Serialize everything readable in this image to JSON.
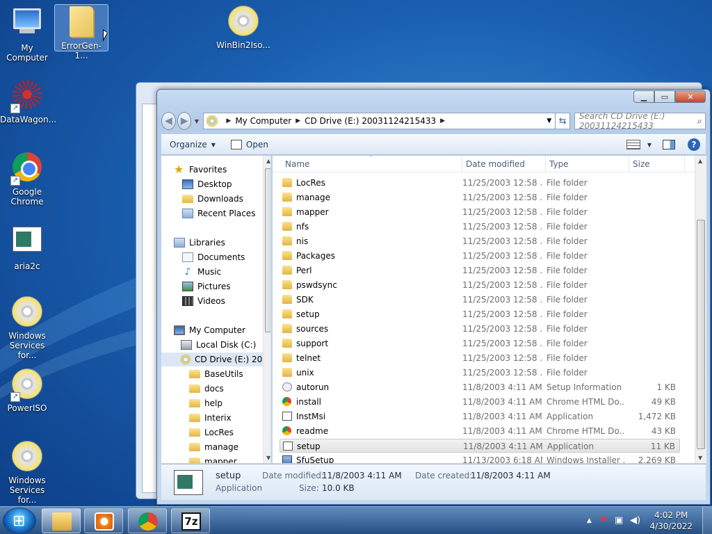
{
  "desktop": {
    "icons": [
      {
        "label": "My Computer"
      },
      {
        "label": "ErrorGen-1..."
      },
      {
        "label": "WinBin2Iso..."
      },
      {
        "label": "DataWagon..."
      },
      {
        "label": "Google Chrome"
      },
      {
        "label": "aria2c"
      },
      {
        "label": "Windows Services for..."
      },
      {
        "label": "PowerISO"
      },
      {
        "label": "Windows Services for..."
      }
    ]
  },
  "window": {
    "address": {
      "root": "My Computer",
      "drive": "CD Drive (E:) 20031124215433"
    },
    "search_placeholder": "Search CD Drive (E:) 20031124215433",
    "toolbar": {
      "organize": "Organize",
      "open": "Open"
    },
    "nav": {
      "favorites": "Favorites",
      "desktop": "Desktop",
      "downloads": "Downloads",
      "recent": "Recent Places",
      "libraries": "Libraries",
      "documents": "Documents",
      "music": "Music",
      "pictures": "Pictures",
      "videos": "Videos",
      "computer": "My Computer",
      "local_disk": "Local Disk (C:)",
      "cd_drive": "CD Drive (E:) 2003",
      "subfolders": [
        "BaseUtils",
        "docs",
        "help",
        "Interix",
        "LocRes",
        "manage",
        "mapper"
      ]
    },
    "columns": {
      "name": "Name",
      "date": "Date modified",
      "type": "Type",
      "size": "Size"
    },
    "files": [
      {
        "name": "LocRes",
        "date": "11/25/2003 12:58 ...",
        "type": "File folder",
        "size": "",
        "icon": "folder"
      },
      {
        "name": "manage",
        "date": "11/25/2003 12:58 ...",
        "type": "File folder",
        "size": "",
        "icon": "folder"
      },
      {
        "name": "mapper",
        "date": "11/25/2003 12:58 ...",
        "type": "File folder",
        "size": "",
        "icon": "folder"
      },
      {
        "name": "nfs",
        "date": "11/25/2003 12:58 ...",
        "type": "File folder",
        "size": "",
        "icon": "folder"
      },
      {
        "name": "nis",
        "date": "11/25/2003 12:58 ...",
        "type": "File folder",
        "size": "",
        "icon": "folder"
      },
      {
        "name": "Packages",
        "date": "11/25/2003 12:58 ...",
        "type": "File folder",
        "size": "",
        "icon": "folder"
      },
      {
        "name": "Perl",
        "date": "11/25/2003 12:58 ...",
        "type": "File folder",
        "size": "",
        "icon": "folder"
      },
      {
        "name": "pswdsync",
        "date": "11/25/2003 12:58 ...",
        "type": "File folder",
        "size": "",
        "icon": "folder"
      },
      {
        "name": "SDK",
        "date": "11/25/2003 12:58 ...",
        "type": "File folder",
        "size": "",
        "icon": "folder"
      },
      {
        "name": "setup",
        "date": "11/25/2003 12:58 ...",
        "type": "File folder",
        "size": "",
        "icon": "folder"
      },
      {
        "name": "sources",
        "date": "11/25/2003 12:58 ...",
        "type": "File folder",
        "size": "",
        "icon": "folder"
      },
      {
        "name": "support",
        "date": "11/25/2003 12:58 ...",
        "type": "File folder",
        "size": "",
        "icon": "folder"
      },
      {
        "name": "telnet",
        "date": "11/25/2003 12:58 ...",
        "type": "File folder",
        "size": "",
        "icon": "folder"
      },
      {
        "name": "unix",
        "date": "11/25/2003 12:58 ...",
        "type": "File folder",
        "size": "",
        "icon": "folder"
      },
      {
        "name": "autorun",
        "date": "11/8/2003 4:11 AM",
        "type": "Setup Information",
        "size": "1 KB",
        "icon": "inf"
      },
      {
        "name": "install",
        "date": "11/8/2003 4:11 AM",
        "type": "Chrome HTML Do...",
        "size": "49 KB",
        "icon": "chrome"
      },
      {
        "name": "InstMsi",
        "date": "11/8/2003 4:11 AM",
        "type": "Application",
        "size": "1,472 KB",
        "icon": "app"
      },
      {
        "name": "readme",
        "date": "11/8/2003 4:11 AM",
        "type": "Chrome HTML Do...",
        "size": "43 KB",
        "icon": "chrome"
      },
      {
        "name": "setup",
        "date": "11/8/2003 4:11 AM",
        "type": "Application",
        "size": "11 KB",
        "icon": "app",
        "selected": true
      },
      {
        "name": "SfuSetup",
        "date": "11/13/2003 6:18 AM",
        "type": "Windows Installer ...",
        "size": "2,269 KB",
        "icon": "msi"
      }
    ],
    "details": {
      "name": "setup",
      "type": "Application",
      "modified_label": "Date modified:",
      "modified_value": "11/8/2003 4:11 AM",
      "created_label": "Date created:",
      "created_value": "11/8/2003 4:11 AM",
      "size_label": "Size:",
      "size_value": "10.0 KB"
    }
  },
  "taskbar": {
    "apps": [
      "explorer-icon",
      "media-player-icon",
      "chrome-icon",
      "7zip-icon"
    ],
    "zip_label": "7z",
    "time": "4:02 PM",
    "date": "4/30/2022"
  }
}
